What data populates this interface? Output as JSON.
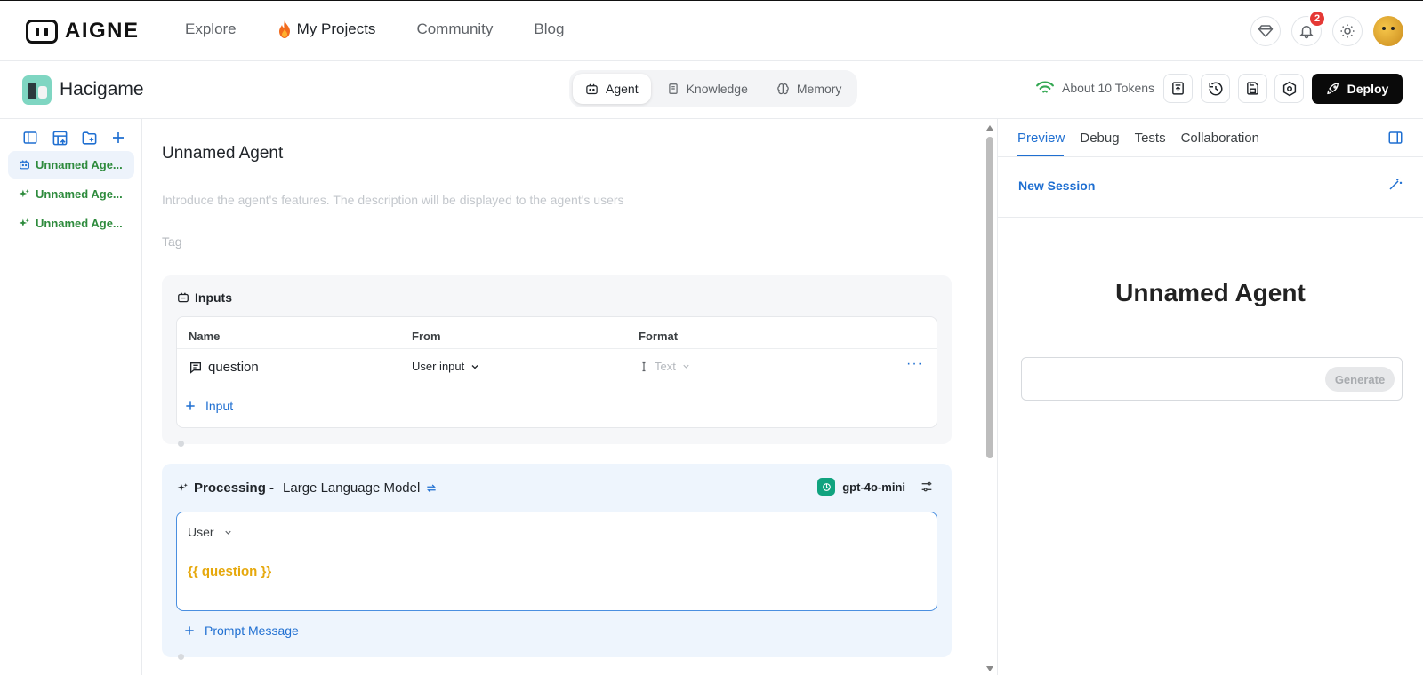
{
  "brand": {
    "name": "AIGNE"
  },
  "nav": {
    "items": [
      {
        "label": "Explore"
      },
      {
        "label": "My Projects"
      },
      {
        "label": "Community"
      },
      {
        "label": "Blog"
      }
    ],
    "notification_count": "2"
  },
  "project": {
    "name": "Hacigame",
    "tabs": [
      {
        "label": "Agent",
        "icon": "agent-icon"
      },
      {
        "label": "Knowledge",
        "icon": "book-icon"
      },
      {
        "label": "Memory",
        "icon": "brain-icon"
      }
    ],
    "tokens": "About 10 Tokens",
    "deploy_label": "Deploy"
  },
  "sidebar": {
    "items": [
      {
        "label": "Unnamed Age..."
      },
      {
        "label": "Unnamed Age..."
      },
      {
        "label": "Unnamed Age..."
      }
    ]
  },
  "editor": {
    "title": "Unnamed Agent",
    "description_placeholder": "Introduce the agent's features. The description will be displayed to the agent's users",
    "tag_placeholder": "Tag",
    "inputs": {
      "title": "Inputs",
      "columns": [
        "Name",
        "From",
        "Format"
      ],
      "rows": [
        {
          "name": "question",
          "from": "User input",
          "format": "Text"
        }
      ],
      "add_label": "Input"
    },
    "processing": {
      "prefix": "Processing -",
      "type": "Large Language Model",
      "model": "gpt-4o-mini",
      "role": "User",
      "prompt": "{{ question }}",
      "add_label": "Prompt Message"
    }
  },
  "right_panel": {
    "tabs": [
      {
        "label": "Preview"
      },
      {
        "label": "Debug"
      },
      {
        "label": "Tests"
      },
      {
        "label": "Collaboration"
      }
    ],
    "new_session": "New Session",
    "preview_title": "Unnamed Agent",
    "generate_label": "Generate"
  },
  "colors": {
    "accent": "#1f6fd1",
    "sidebar_text": "#2e8b3d",
    "prompt_variable": "#e6a80c",
    "deploy_bg": "#0a0a0a"
  }
}
